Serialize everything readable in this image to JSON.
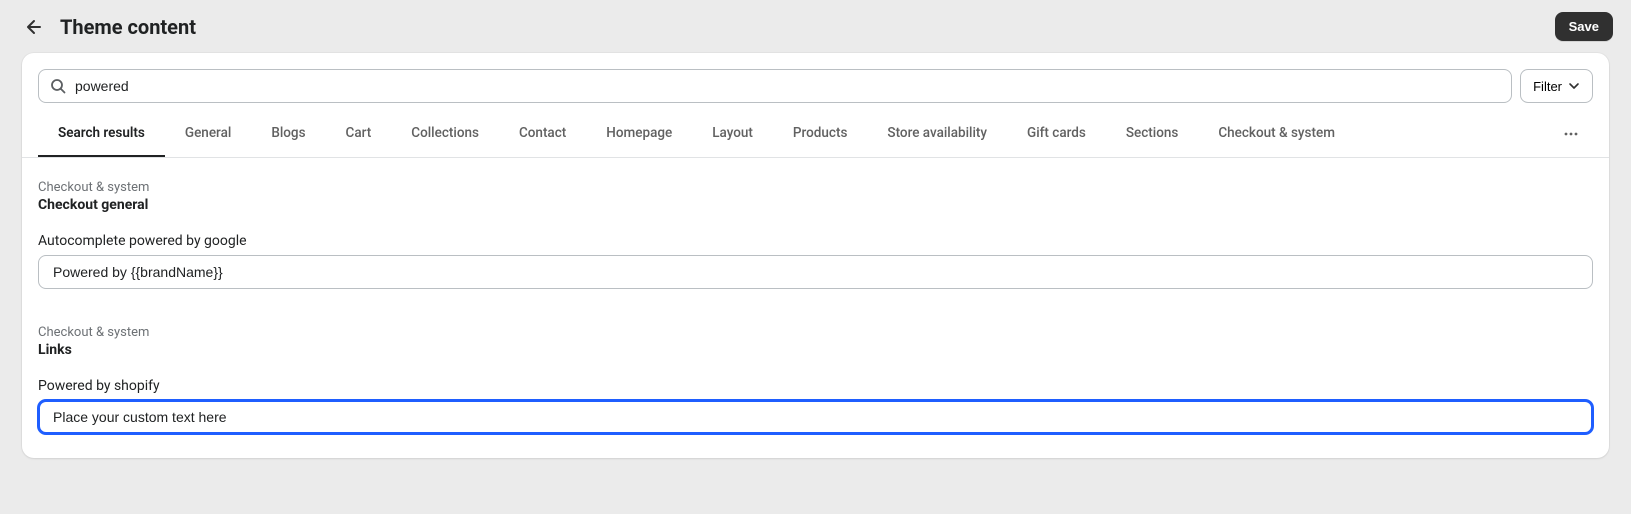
{
  "header": {
    "title": "Theme content",
    "save_label": "Save"
  },
  "search": {
    "value": "powered",
    "placeholder": ""
  },
  "filter_label": "Filter",
  "tabs": [
    "Search results",
    "General",
    "Blogs",
    "Cart",
    "Collections",
    "Contact",
    "Homepage",
    "Layout",
    "Products",
    "Store availability",
    "Gift cards",
    "Sections",
    "Checkout & system"
  ],
  "sections": [
    {
      "category": "Checkout & system",
      "title": "Checkout general",
      "field_label": "Autocomplete powered by google",
      "field_value": "Powered by {{brandName}}",
      "focused": false
    },
    {
      "category": "Checkout & system",
      "title": "Links",
      "field_label": "Powered by shopify",
      "field_value": "Place your custom text here ",
      "focused": true
    }
  ]
}
